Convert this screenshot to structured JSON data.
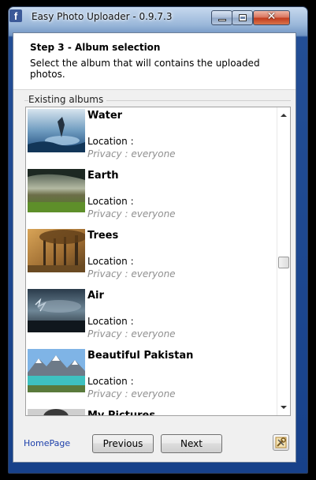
{
  "window": {
    "title": "Easy Photo Uploader - 0.9.7.3",
    "icon": "facebook-icon"
  },
  "header": {
    "step_title": "Step 3 - Album selection",
    "step_description": "Select the album that will contains the uploaded photos."
  },
  "albums_group": {
    "label": "Existing albums",
    "items": [
      {
        "name": "Water",
        "location": "Location :",
        "privacy": "Privacy : everyone",
        "thumbnail": "water-photo"
      },
      {
        "name": "Earth",
        "location": "Location :",
        "privacy": "Privacy : everyone",
        "thumbnail": "earth-photo"
      },
      {
        "name": "Trees",
        "location": "Location :",
        "privacy": "Privacy : everyone",
        "thumbnail": "trees-photo"
      },
      {
        "name": "Air",
        "location": "Location :",
        "privacy": "Privacy : everyone",
        "thumbnail": "air-photo"
      },
      {
        "name": "Beautiful Pakistan",
        "location": "Location :",
        "privacy": "Privacy : everyone",
        "thumbnail": "mountain-lake-photo"
      },
      {
        "name": "My Pictures",
        "location": "",
        "privacy": "",
        "thumbnail": "portrait-photo"
      }
    ]
  },
  "footer": {
    "homepage_link": "HomePage",
    "previous_label": "Previous",
    "next_label": "Next",
    "settings_icon": "tools-icon"
  }
}
